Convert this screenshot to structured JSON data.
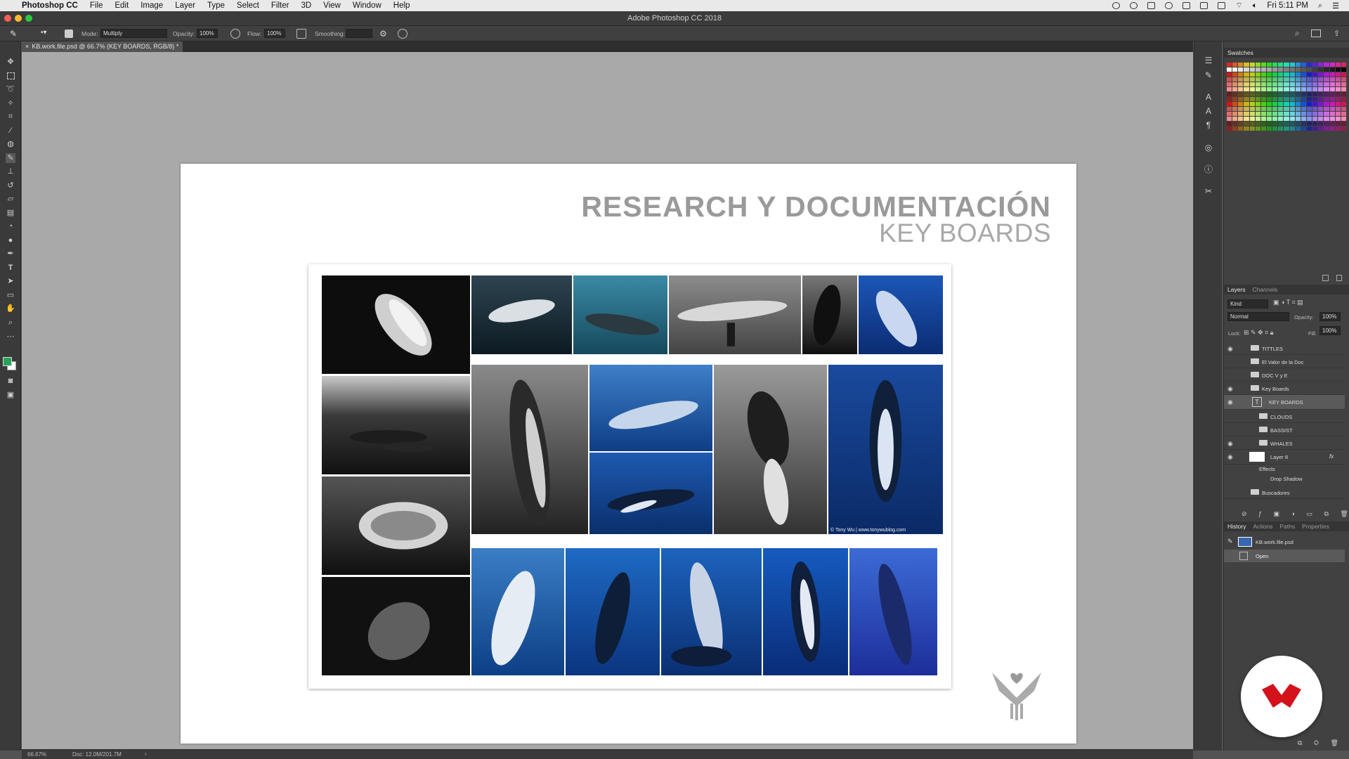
{
  "menubar": {
    "app": "Photoshop CC",
    "items": [
      "File",
      "Edit",
      "Image",
      "Layer",
      "Type",
      "Select",
      "Filter",
      "3D",
      "View",
      "Window",
      "Help"
    ],
    "clock": "Fri 5:11 PM"
  },
  "window": {
    "title": "Adobe Photoshop CC 2018"
  },
  "options": {
    "mode_label": "Mode:",
    "mode_value": "Multiply",
    "opacity_label": "Opacity:",
    "opacity_value": "100%",
    "flow_label": "Flow:",
    "flow_value": "100%",
    "smoothing_label": "Smoothing:"
  },
  "document_tab": {
    "label": "KB.work.file.psd @ 66.7% (KEY BOARDS, RGB/8) *"
  },
  "artboard": {
    "title": "RESEARCH Y DOCUMENTACIÓN",
    "subtitle": "KEY BOARDS",
    "credit": "© Tony Wu | www.tonywublog.com"
  },
  "panels": {
    "swatches": {
      "title": "Swatches"
    },
    "layers": {
      "tabs": [
        "Layers",
        "Channels"
      ],
      "kind": "Kind",
      "blend": "Normal",
      "opacity_label": "Opacity:",
      "opacity_value": "100%",
      "lock_label": "Lock:",
      "fill_label": "Fill:",
      "fill_value": "100%",
      "rows": [
        "TITTLES",
        "El Valor de la Doc",
        "DOC V y E",
        "Key Boards",
        "KEY BOARDS",
        "CLOUDS",
        "BASSIST",
        "WHALES",
        "Layer 8",
        "Effects",
        "Drop Shadow",
        "Buscadores"
      ]
    },
    "history": {
      "tabs": [
        "History",
        "Actions",
        "Paths",
        "Properties"
      ],
      "snapshot": "KB.work.file.psd",
      "step": "Open"
    }
  },
  "status": {
    "zoom": "66.67%",
    "doc": "Doc: 12.0M/201.7M"
  },
  "colors": {
    "accent_red": "#d4121c",
    "foreground_swatch": "#27a35a"
  }
}
